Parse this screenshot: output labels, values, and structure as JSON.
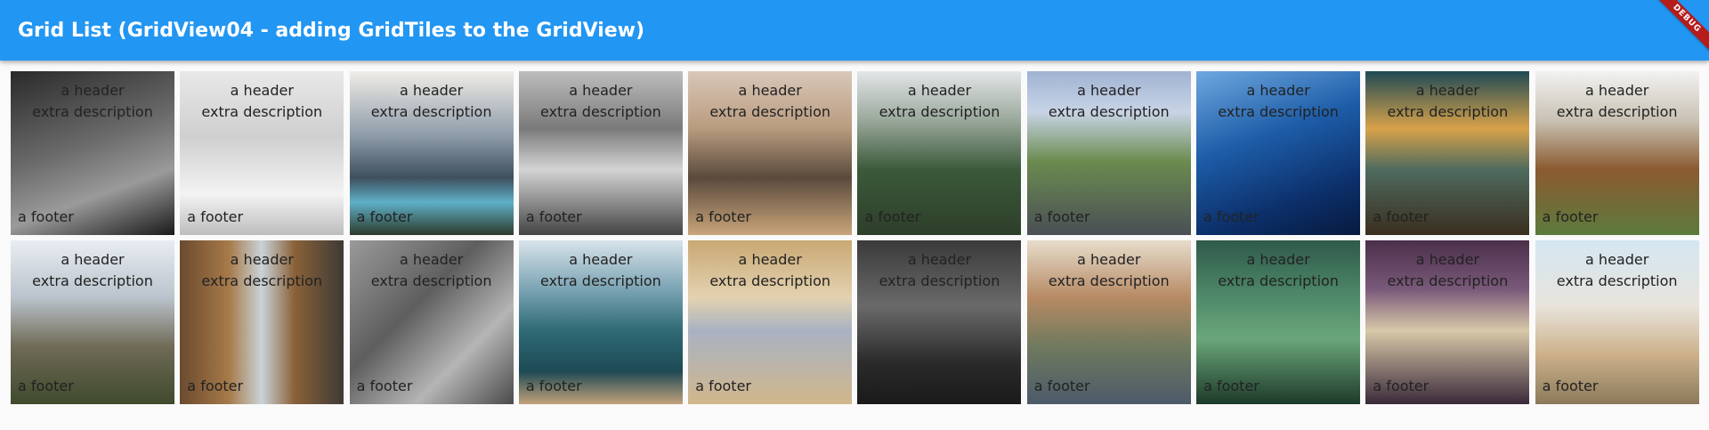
{
  "appbar": {
    "title": "Grid List (GridView04 - adding GridTiles to the GridView)"
  },
  "debug_banner": "DEBUG",
  "tiles": [
    {
      "header": "a header",
      "description": "extra description",
      "footer": "a footer",
      "bg": "linear-gradient(160deg,#2a2a2a 0%,#6b6b6b 45%,#9a9a9a 70%,#1a1a1a 100%)"
    },
    {
      "header": "a header",
      "description": "extra description",
      "footer": "a footer",
      "bg": "linear-gradient(180deg,#e8e8e8 0%,#cfcfcf 40%,#f3f3f3 75%,#bdbdbd 100%)"
    },
    {
      "header": "a header",
      "description": "extra description",
      "footer": "a footer",
      "bg": "linear-gradient(180deg,#f0ede6 0%,#8c9aa8 40%,#3e4f5e 65%,#5fb0c8 80%,#2c3a2c 100%)"
    },
    {
      "header": "a header",
      "description": "extra description",
      "footer": "a footer",
      "bg": "linear-gradient(180deg,#bdbdbd 0%,#7a7a7a 35%,#d4d4d4 60%,#444 100%)"
    },
    {
      "header": "a header",
      "description": "extra description",
      "footer": "a footer",
      "bg": "linear-gradient(180deg,#d9c7b8 0%,#b99b7f 35%,#5a4a3c 65%,#c9a57a 100%)"
    },
    {
      "header": "a header",
      "description": "extra description",
      "footer": "a footer",
      "bg": "linear-gradient(180deg,#e3e6e8 0%,#9aa89b 30%,#3b5a3a 60%,#2e3e2a 100%)"
    },
    {
      "header": "a header",
      "description": "extra description",
      "footer": "a footer",
      "bg": "linear-gradient(180deg,#9fb3d2 0%,#c8d4e6 25%,#6b8b4f 55%,#4a4f55 100%)"
    },
    {
      "header": "a header",
      "description": "extra description",
      "footer": "a footer",
      "bg": "linear-gradient(160deg,#6fa8e0 0%,#1d5da8 40%,#0c2f6a 75%,#071a3d 100%)"
    },
    {
      "header": "a header",
      "description": "extra description",
      "footer": "a footer",
      "bg": "linear-gradient(180deg,#1f4a55 0%,#d8a24a 35%,#4f6b5f 60%,#3a2e1f 100%)"
    },
    {
      "header": "a header",
      "description": "extra description",
      "footer": "a footer",
      "bg": "linear-gradient(180deg,#f2f2f2 0%,#c9c2b3 30%,#8b5a30 60%,#5d7a3d 100%)"
    },
    {
      "header": "a header",
      "description": "extra description",
      "footer": "a footer",
      "bg": "linear-gradient(180deg,#e8edf2 0%,#bac3cc 35%,#6f6a56 65%,#3f4a2c 100%)"
    },
    {
      "header": "a header",
      "description": "extra description",
      "footer": "a footer",
      "bg": "linear-gradient(90deg,#6b4a2f 0%,#a77a4a 30%,#c9d3d8 50%,#8a6138 70%,#3e3a36 100%)"
    },
    {
      "header": "a header",
      "description": "extra description",
      "footer": "a footer",
      "bg": "linear-gradient(135deg,#9a9a9a 0%,#5e5e5e 40%,#b5b5b5 70%,#4a4a4a 100%)"
    },
    {
      "header": "a header",
      "description": "extra description",
      "footer": "a footer",
      "bg": "linear-gradient(180deg,#d8e3ea 0%,#7aa3b3 30%,#2f6a75 55%,#1e4a55 80%,#c2a27a 100%)"
    },
    {
      "header": "a header",
      "description": "extra description",
      "footer": "a footer",
      "bg": "linear-gradient(180deg,#c9a874 0%,#e3d2b0 35%,#a9b2c2 55%,#d1b78c 100%)"
    },
    {
      "header": "a header",
      "description": "extra description",
      "footer": "a footer",
      "bg": "linear-gradient(180deg,#3a3a3a 0%,#6a6a6a 40%,#2a2a2a 75%,#1a1a1a 100%)"
    },
    {
      "header": "a header",
      "description": "extra description",
      "footer": "a footer",
      "bg": "linear-gradient(180deg,#e6dccb 0%,#b78a64 35%,#6f7a5e 65%,#4c5a6a 100%)"
    },
    {
      "header": "a header",
      "description": "extra description",
      "footer": "a footer",
      "bg": "linear-gradient(180deg,#2f5a4a 0%,#4f8a6a 35%,#6aa67a 60%,#1e3a2a 100%)"
    },
    {
      "header": "a header",
      "description": "extra description",
      "footer": "a footer",
      "bg": "linear-gradient(180deg,#4a2f4a 0%,#7a5a7a 30%,#d8c8a8 55%,#3a2a3a 100%)"
    },
    {
      "header": "a header",
      "description": "extra description",
      "footer": "a footer",
      "bg": "linear-gradient(180deg,#d4e6f2 0%,#e8e4dc 40%,#cdb08a 70%,#8a7a5a 100%)"
    }
  ]
}
